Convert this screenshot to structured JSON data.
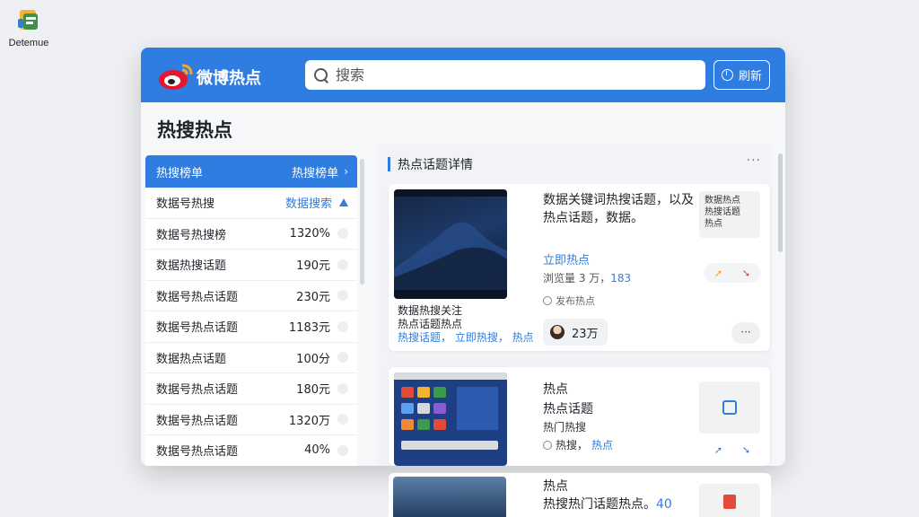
{
  "desktop": {
    "icon_label": "Detemue"
  },
  "header": {
    "app_title": "微博热点",
    "search_placeholder": "搜索",
    "button_label": "刷新"
  },
  "page": {
    "title": "热搜热点"
  },
  "list": {
    "header_left": "热搜榜单",
    "header_right": "热搜榜单",
    "rows": [
      {
        "label": "数据号热搜",
        "value": "数据搜索"
      },
      {
        "label": "数据号热搜榜",
        "value": "1320%"
      },
      {
        "label": "数据热搜话题",
        "value": "190元"
      },
      {
        "label": "数据号热点话题",
        "value": "230元"
      },
      {
        "label": "数据号热点话题",
        "value": "1183元"
      },
      {
        "label": "数据热点话题",
        "value": "100分"
      },
      {
        "label": "数据号热点话题",
        "value": "180元"
      },
      {
        "label": "数据号热点话题",
        "value": "1320万"
      },
      {
        "label": "数据号热点话题",
        "value": "40%"
      }
    ]
  },
  "detail": {
    "title": "热点话题详情",
    "more": "···",
    "card1": {
      "headline": "数据关键词热搜话题，以及热点话题，数据。",
      "tag": "立即热点",
      "meta_prefix": "浏览量 3 万，",
      "meta_num": "183",
      "hint": "发布热点",
      "side_text": "数据热点\n热搜话题\n热点",
      "caption_line1": "数据热搜关注",
      "caption_line2": "热点话题热点",
      "caption_line3": "热搜话题，  立即热搜，  热点",
      "user_count": "23万",
      "menu": "···"
    },
    "card2": {
      "line1": "热点",
      "line2": "热点话题",
      "line3": "热门热搜",
      "line4_prefix": "热搜，",
      "line4_blue": "热点"
    },
    "card3": {
      "line1": "热点",
      "line2_prefix": "热搜热门话题热点。",
      "line2_blue": "40"
    }
  },
  "colors": {
    "accent": "#2f7de1",
    "window_bg": "#f6f7f9"
  }
}
